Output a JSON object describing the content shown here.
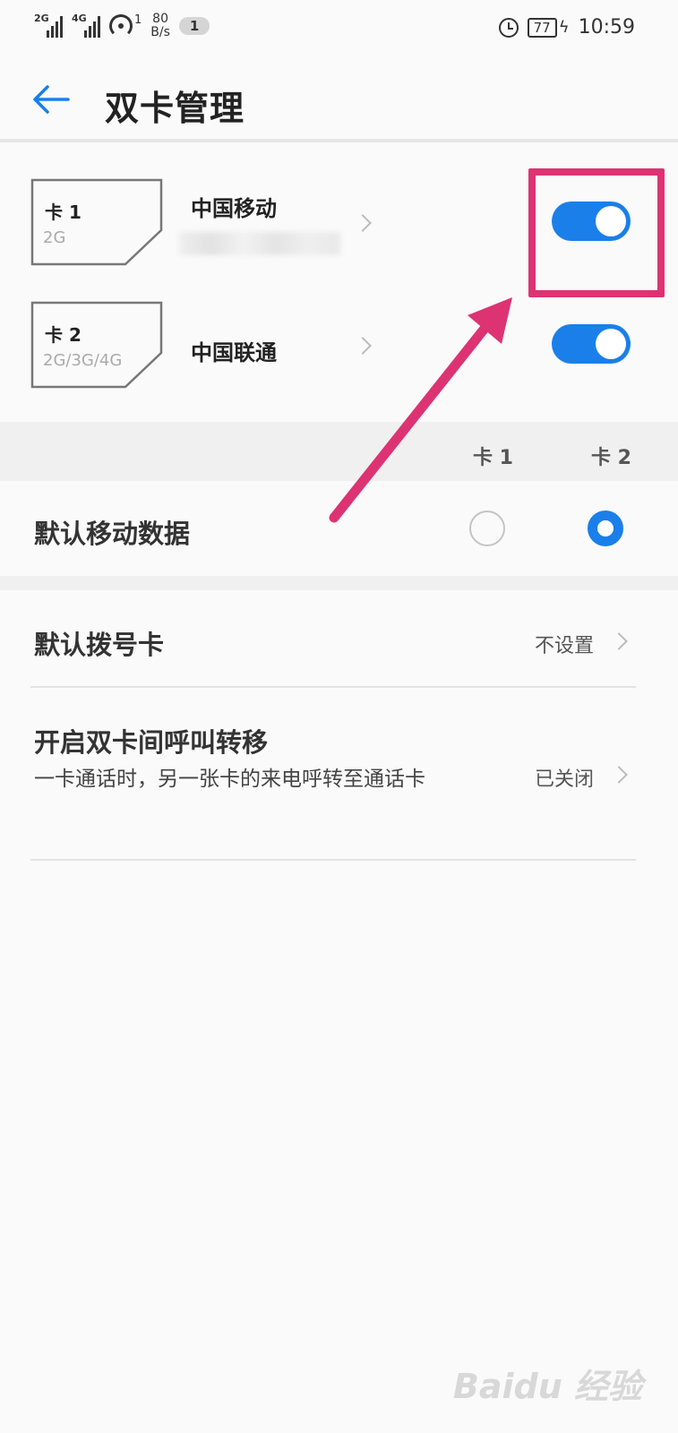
{
  "status_bar": {
    "signal1_label": "2G",
    "signal2_label": "4G",
    "hotspot_count": "1",
    "speed_value": "80",
    "speed_unit": "B/s",
    "notification_count": "1",
    "battery": "77",
    "time": "10:59"
  },
  "header": {
    "title": "双卡管理"
  },
  "sims": [
    {
      "name": "卡 1",
      "network": "2G",
      "carrier": "中国移动",
      "enabled": true
    },
    {
      "name": "卡 2",
      "network": "2G/3G/4G",
      "carrier": "中国联通",
      "enabled": true
    }
  ],
  "columns": {
    "card1": "卡 1",
    "card2": "卡 2"
  },
  "default_data": {
    "label": "默认移动数据",
    "selected": "卡 2"
  },
  "default_dial": {
    "label": "默认拨号卡",
    "value": "不设置"
  },
  "call_forward": {
    "label": "开启双卡间呼叫转移",
    "description": "一卡通话时，另一张卡的来电呼转至通话卡",
    "value": "已关闭"
  },
  "colors": {
    "accent": "#1a7fe9",
    "annotation": "#dd3373"
  },
  "icons": [
    "back-arrow-icon",
    "alarm-icon",
    "battery-icon",
    "hotspot-icon",
    "chevron-right-icon"
  ]
}
